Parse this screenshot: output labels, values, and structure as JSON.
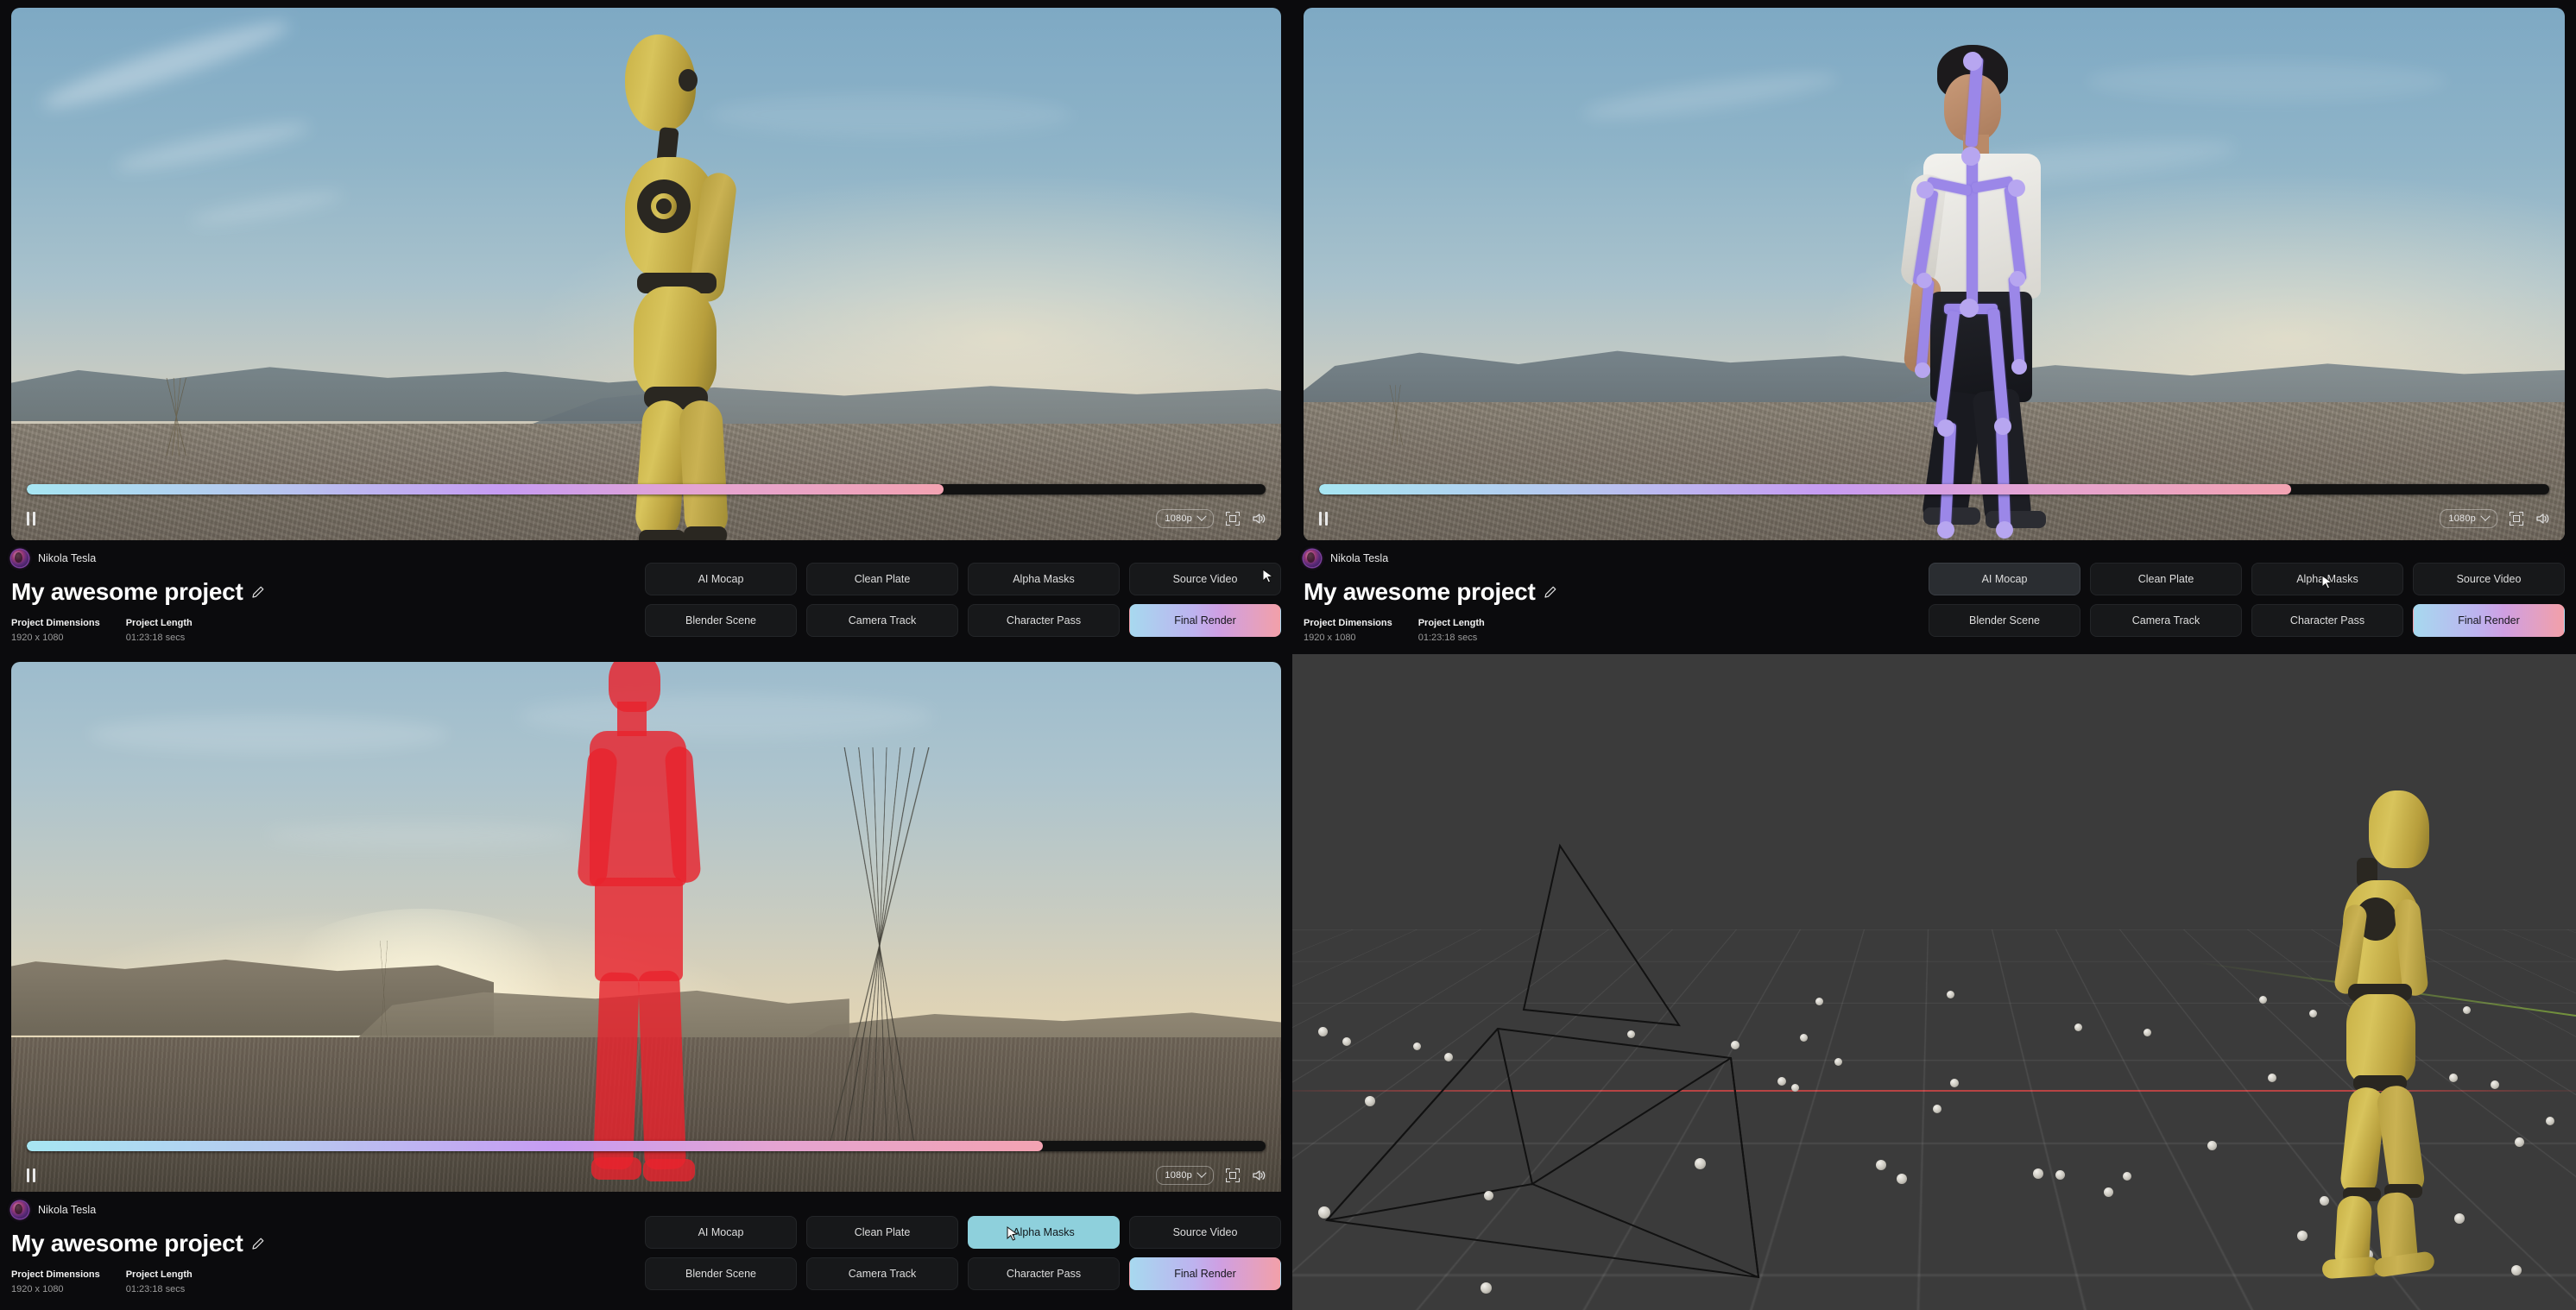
{
  "app": {
    "accent_cyan": "#8ed0dc",
    "accent_pink": "#f2a0a9",
    "accent_purple": "#c79cf2",
    "panel_bg": "#0b0b0d",
    "button_bg": "#17181a"
  },
  "panels": [
    {
      "id": "top-left",
      "view": "Source Video",
      "user": "Nikola Tesla",
      "title": "My awesome project",
      "meta": [
        {
          "key": "Project Dimensions",
          "value": "1920 x 1080"
        },
        {
          "key": "Project Length",
          "value": "01:23:18 secs"
        }
      ],
      "player": {
        "state_icon": "pause-icon",
        "progress_percent": 74,
        "quality": "1080p",
        "quality_caret": "chevron-down-icon",
        "fullscreen_icon": "fullscreen-icon",
        "volume_icon": "volume-icon"
      },
      "passes": [
        {
          "label": "AI Mocap",
          "state": "default"
        },
        {
          "label": "Clean Plate",
          "state": "default"
        },
        {
          "label": "Alpha Masks",
          "state": "default"
        },
        {
          "label": "Source Video",
          "state": "default"
        },
        {
          "label": "Blender Scene",
          "state": "default"
        },
        {
          "label": "Camera Track",
          "state": "default"
        },
        {
          "label": "Character Pass",
          "state": "default"
        },
        {
          "label": "Final Render",
          "state": "gradient"
        }
      ]
    },
    {
      "id": "top-right",
      "view": "AI Mocap",
      "user": "Nikola Tesla",
      "title": "My awesome project",
      "meta": [
        {
          "key": "Project Dimensions",
          "value": "1920 x 1080"
        },
        {
          "key": "Project Length",
          "value": "01:23:18 secs"
        }
      ],
      "player": {
        "state_icon": "pause-icon",
        "progress_percent": 79,
        "quality": "1080p",
        "quality_caret": "chevron-down-icon",
        "fullscreen_icon": "fullscreen-icon",
        "volume_icon": "volume-icon"
      },
      "passes": [
        {
          "label": "AI Mocap",
          "state": "hover"
        },
        {
          "label": "Clean Plate",
          "state": "default"
        },
        {
          "label": "Alpha Masks",
          "state": "default"
        },
        {
          "label": "Source Video",
          "state": "default"
        },
        {
          "label": "Blender Scene",
          "state": "default"
        },
        {
          "label": "Camera Track",
          "state": "default"
        },
        {
          "label": "Character Pass",
          "state": "default"
        },
        {
          "label": "Final Render",
          "state": "gradient"
        }
      ]
    },
    {
      "id": "bottom-left",
      "view": "Alpha Masks",
      "user": "Nikola Tesla",
      "title": "My awesome project",
      "meta": [
        {
          "key": "Project Dimensions",
          "value": "1920 x 1080"
        },
        {
          "key": "Project Length",
          "value": "01:23:18 secs"
        }
      ],
      "player": {
        "state_icon": "pause-icon",
        "progress_percent": 82,
        "quality": "1080p",
        "quality_caret": "chevron-down-icon",
        "fullscreen_icon": "fullscreen-icon",
        "volume_icon": "volume-icon"
      },
      "passes": [
        {
          "label": "AI Mocap",
          "state": "default"
        },
        {
          "label": "Clean Plate",
          "state": "default"
        },
        {
          "label": "Alpha Masks",
          "state": "active"
        },
        {
          "label": "Source Video",
          "state": "default"
        },
        {
          "label": "Blender Scene",
          "state": "default"
        },
        {
          "label": "Camera Track",
          "state": "default"
        },
        {
          "label": "Character Pass",
          "state": "default"
        },
        {
          "label": "Final Render",
          "state": "gradient"
        }
      ]
    },
    {
      "id": "bottom-right",
      "view": "Blender Scene",
      "viewport": {
        "type": "3d-viewport",
        "has_grid": true,
        "axis_x_color": "#cd4646",
        "axis_y_color": "#82aa3c",
        "objects": [
          "camera-frustum",
          "tracking-points",
          "mannequin-character"
        ]
      }
    }
  ]
}
